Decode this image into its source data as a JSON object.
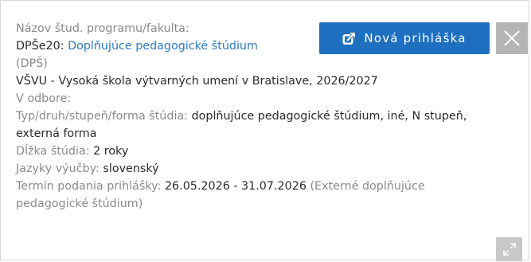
{
  "program": {
    "name_label": "Názov štud. programu/fakulta:",
    "code": "DPŠe20:",
    "name_link": "Doplňujúce pedagogické štúdium",
    "abbrev": "(DPŠ)",
    "faculty_year": "VŠVU - Vysoká škola výtvarných umení v Bratislave, 2026/2027",
    "field_label": "V odbore:",
    "type_label": "Typ/druh/stupeň/forma štúdia:",
    "type_value": "doplňujúce pedagogické štúdium, iné, N stupeň, externá forma",
    "duration_label": "Dĺžka štúdia:",
    "duration_value": "2 roky",
    "languages_label": "Jazyky výučby:",
    "languages_value": "slovenský",
    "deadline_label": "Termín podania prihlášky:",
    "deadline_value": "26.05.2026 - 31.07.2026",
    "deadline_note": "(Externé doplňujúce pedagogické štúdium)"
  },
  "actions": {
    "apply_label": "Nová prihláška",
    "apply_icon": "external-link-icon",
    "close_icon": "close-icon",
    "expand_icon": "expand-icon"
  },
  "colors": {
    "accent": "#1f6fc0",
    "link": "#2b7bc3",
    "label": "#8a8a8a",
    "close_bg": "#b5b5b5"
  }
}
